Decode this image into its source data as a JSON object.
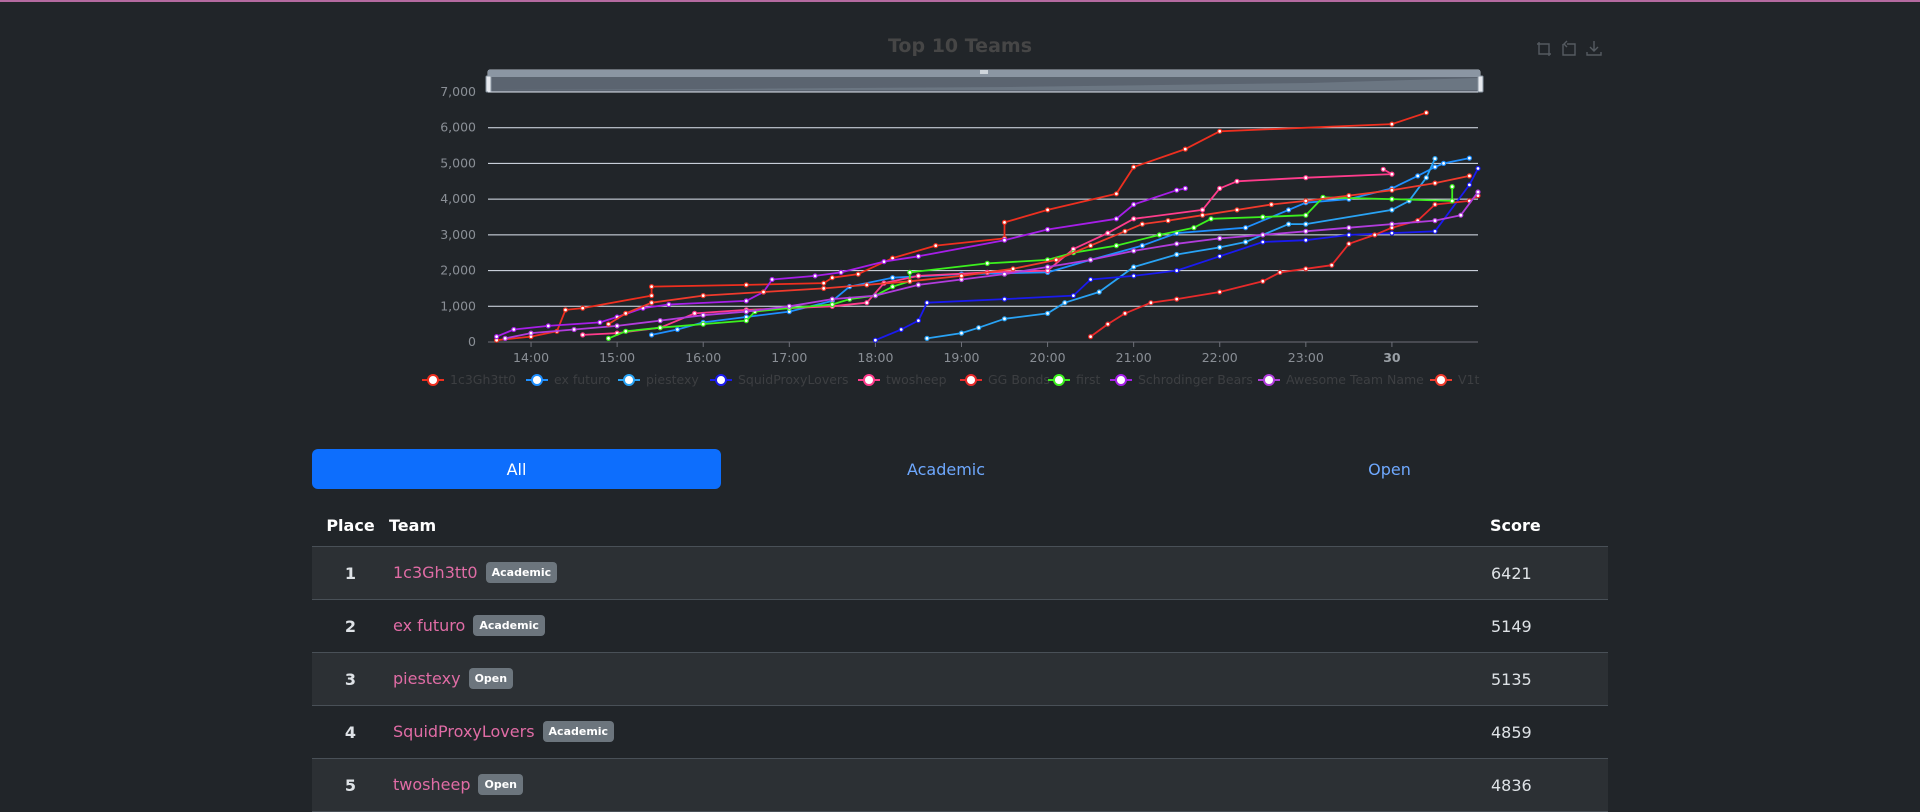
{
  "chart_data": {
    "type": "line",
    "title": "Top 10 Teams",
    "xlabel": "",
    "ylabel": "",
    "x_unit": "hours (day 29 13:30 through day 30 01:00, 24h = 30 00:00)",
    "x_tick_labels": [
      "14:00",
      "15:00",
      "16:00",
      "17:00",
      "18:00",
      "19:00",
      "20:00",
      "21:00",
      "22:00",
      "23:00",
      "30"
    ],
    "xlim": [
      13.5,
      25.0
    ],
    "ylim": [
      0,
      7000
    ],
    "y_ticks": [
      0,
      1000,
      2000,
      3000,
      4000,
      5000,
      6000,
      7000
    ],
    "y_tick_labels": [
      "0",
      "1,000",
      "2,000",
      "3,000",
      "4,000",
      "5,000",
      "6,000",
      "7,000"
    ],
    "grid": true,
    "legend_position": "bottom",
    "series": [
      {
        "name": "1c3Gh3tt0",
        "color": "#ee2f1f",
        "points": [
          [
            13.6,
            50
          ],
          [
            14.0,
            150
          ],
          [
            14.3,
            300
          ],
          [
            14.4,
            900
          ],
          [
            14.6,
            950
          ],
          [
            15.4,
            1300
          ],
          [
            15.4,
            1550
          ],
          [
            16.5,
            1600
          ],
          [
            17.4,
            1650
          ],
          [
            17.5,
            1800
          ],
          [
            17.8,
            1900
          ],
          [
            18.2,
            2350
          ],
          [
            18.7,
            2700
          ],
          [
            19.5,
            2900
          ],
          [
            19.5,
            3350
          ],
          [
            20.0,
            3700
          ],
          [
            20.8,
            4150
          ],
          [
            21.0,
            4900
          ],
          [
            21.6,
            5400
          ],
          [
            22.0,
            5900
          ],
          [
            24.0,
            6100
          ],
          [
            24.4,
            6421
          ]
        ]
      },
      {
        "name": "ex futuro",
        "color": "#1e8fff",
        "points": [
          [
            15.4,
            200
          ],
          [
            15.7,
            350
          ],
          [
            16.0,
            550
          ],
          [
            16.5,
            700
          ],
          [
            17.0,
            850
          ],
          [
            17.5,
            1150
          ],
          [
            17.7,
            1550
          ],
          [
            18.2,
            1800
          ],
          [
            19.0,
            1900
          ],
          [
            20.0,
            1950
          ],
          [
            20.5,
            2300
          ],
          [
            21.1,
            2700
          ],
          [
            21.5,
            3050
          ],
          [
            22.3,
            3200
          ],
          [
            22.8,
            3700
          ],
          [
            23.0,
            3900
          ],
          [
            23.5,
            4000
          ],
          [
            24.0,
            4300
          ],
          [
            24.3,
            4650
          ],
          [
            24.5,
            4900
          ],
          [
            24.6,
            5000
          ],
          [
            24.9,
            5149
          ]
        ]
      },
      {
        "name": "piestexy",
        "color": "#29a3f5",
        "points": [
          [
            18.6,
            100
          ],
          [
            19.0,
            250
          ],
          [
            19.2,
            400
          ],
          [
            19.5,
            650
          ],
          [
            20.0,
            800
          ],
          [
            20.2,
            1100
          ],
          [
            20.6,
            1400
          ],
          [
            21.0,
            2100
          ],
          [
            21.5,
            2450
          ],
          [
            22.0,
            2650
          ],
          [
            22.3,
            2800
          ],
          [
            22.8,
            3300
          ],
          [
            23.0,
            3300
          ],
          [
            24.0,
            3700
          ],
          [
            24.2,
            3950
          ],
          [
            24.4,
            4600
          ],
          [
            24.5,
            5135
          ]
        ]
      },
      {
        "name": "SquidProxyLovers",
        "color": "#1a1aef",
        "points": [
          [
            18.0,
            50
          ],
          [
            18.3,
            350
          ],
          [
            18.5,
            600
          ],
          [
            18.6,
            1100
          ],
          [
            19.5,
            1200
          ],
          [
            20.3,
            1300
          ],
          [
            20.5,
            1750
          ],
          [
            21.0,
            1850
          ],
          [
            21.5,
            2000
          ],
          [
            22.0,
            2400
          ],
          [
            22.5,
            2800
          ],
          [
            23.0,
            2850
          ],
          [
            23.5,
            3000
          ],
          [
            24.0,
            3050
          ],
          [
            24.5,
            3100
          ],
          [
            24.9,
            4400
          ],
          [
            25.0,
            4859
          ]
        ]
      },
      {
        "name": "twosheep",
        "color": "#ff3c8c",
        "points": [
          [
            14.6,
            200
          ],
          [
            15.0,
            250
          ],
          [
            15.5,
            400
          ],
          [
            15.9,
            800
          ],
          [
            16.5,
            900
          ],
          [
            17.5,
            1000
          ],
          [
            17.9,
            1100
          ],
          [
            18.1,
            1650
          ],
          [
            18.5,
            1850
          ],
          [
            19.3,
            1950
          ],
          [
            20.0,
            2000
          ],
          [
            20.3,
            2600
          ],
          [
            20.7,
            3050
          ],
          [
            21.0,
            3450
          ],
          [
            21.8,
            3700
          ],
          [
            22.0,
            4300
          ],
          [
            22.2,
            4500
          ],
          [
            23.0,
            4600
          ],
          [
            24.0,
            4700
          ],
          [
            23.9,
            4836
          ]
        ]
      },
      {
        "name": "GG Bonds",
        "color": "#e82a2a",
        "points": [
          [
            20.5,
            150
          ],
          [
            20.7,
            500
          ],
          [
            20.9,
            800
          ],
          [
            21.2,
            1100
          ],
          [
            21.5,
            1200
          ],
          [
            22.0,
            1400
          ],
          [
            22.5,
            1700
          ],
          [
            22.7,
            1950
          ],
          [
            23.0,
            2050
          ],
          [
            23.3,
            2150
          ],
          [
            23.5,
            2750
          ],
          [
            23.8,
            3000
          ],
          [
            24.0,
            3200
          ],
          [
            24.3,
            3400
          ],
          [
            24.5,
            3850
          ],
          [
            24.9,
            3950
          ],
          [
            25.0,
            4100
          ]
        ]
      },
      {
        "name": "first",
        "color": "#3cf01e",
        "points": [
          [
            14.9,
            100
          ],
          [
            15.1,
            300
          ],
          [
            15.5,
            400
          ],
          [
            16.0,
            500
          ],
          [
            16.5,
            600
          ],
          [
            16.6,
            850
          ],
          [
            17.0,
            950
          ],
          [
            17.5,
            1050
          ],
          [
            17.7,
            1200
          ],
          [
            18.0,
            1300
          ],
          [
            18.2,
            1550
          ],
          [
            18.4,
            1700
          ],
          [
            18.4,
            1950
          ],
          [
            19.3,
            2200
          ],
          [
            20.0,
            2300
          ],
          [
            20.3,
            2500
          ],
          [
            20.8,
            2700
          ],
          [
            21.3,
            3000
          ],
          [
            21.7,
            3200
          ],
          [
            21.9,
            3450
          ],
          [
            22.5,
            3500
          ],
          [
            23.0,
            3550
          ],
          [
            23.2,
            4050
          ],
          [
            24.0,
            4000
          ],
          [
            24.7,
            3950
          ],
          [
            24.7,
            4350
          ]
        ]
      },
      {
        "name": "Schrodinger Bears",
        "color": "#a61ee8",
        "points": [
          [
            13.6,
            150
          ],
          [
            13.8,
            350
          ],
          [
            14.2,
            450
          ],
          [
            14.8,
            550
          ],
          [
            15.0,
            700
          ],
          [
            15.3,
            950
          ],
          [
            15.6,
            1050
          ],
          [
            16.5,
            1150
          ],
          [
            16.7,
            1400
          ],
          [
            16.8,
            1750
          ],
          [
            17.3,
            1850
          ],
          [
            17.6,
            1950
          ],
          [
            18.1,
            2250
          ],
          [
            18.5,
            2400
          ],
          [
            19.5,
            2850
          ],
          [
            20.0,
            3150
          ],
          [
            20.8,
            3450
          ],
          [
            21.0,
            3850
          ],
          [
            21.5,
            4250
          ],
          [
            21.6,
            4300
          ]
        ]
      },
      {
        "name": "Awesome Team Name",
        "color": "#b13cdc",
        "points": [
          [
            13.7,
            100
          ],
          [
            14.0,
            250
          ],
          [
            14.5,
            350
          ],
          [
            15.0,
            450
          ],
          [
            15.5,
            600
          ],
          [
            16.0,
            750
          ],
          [
            16.5,
            850
          ],
          [
            17.0,
            1000
          ],
          [
            17.5,
            1200
          ],
          [
            18.0,
            1300
          ],
          [
            18.5,
            1600
          ],
          [
            19.0,
            1750
          ],
          [
            19.5,
            1900
          ],
          [
            20.0,
            2100
          ],
          [
            20.5,
            2300
          ],
          [
            21.0,
            2550
          ],
          [
            21.5,
            2750
          ],
          [
            22.0,
            2900
          ],
          [
            22.5,
            3000
          ],
          [
            23.0,
            3100
          ],
          [
            23.5,
            3200
          ],
          [
            24.0,
            3300
          ],
          [
            24.5,
            3400
          ],
          [
            24.8,
            3550
          ],
          [
            25.0,
            4200
          ]
        ]
      },
      {
        "name": "V1t",
        "color": "#f03a2c",
        "points": [
          [
            14.9,
            500
          ],
          [
            15.1,
            800
          ],
          [
            15.4,
            1100
          ],
          [
            16.0,
            1300
          ],
          [
            16.7,
            1400
          ],
          [
            17.4,
            1500
          ],
          [
            17.9,
            1600
          ],
          [
            18.4,
            1700
          ],
          [
            19.0,
            1850
          ],
          [
            19.6,
            2050
          ],
          [
            20.1,
            2300
          ],
          [
            20.5,
            2700
          ],
          [
            20.9,
            3100
          ],
          [
            21.1,
            3300
          ],
          [
            21.4,
            3400
          ],
          [
            21.8,
            3550
          ],
          [
            22.2,
            3700
          ],
          [
            22.6,
            3850
          ],
          [
            23.0,
            3950
          ],
          [
            23.5,
            4100
          ],
          [
            24.0,
            4250
          ],
          [
            24.5,
            4450
          ],
          [
            24.9,
            4650
          ]
        ]
      }
    ]
  },
  "tabs": {
    "all": "All",
    "academic": "Academic",
    "open": "Open"
  },
  "table": {
    "headers": {
      "place": "Place",
      "team": "Team",
      "score": "Score"
    },
    "rows": [
      {
        "place": "1",
        "team": "1c3Gh3tt0",
        "division": "Academic",
        "score": "6421"
      },
      {
        "place": "2",
        "team": "ex futuro",
        "division": "Academic",
        "score": "5149"
      },
      {
        "place": "3",
        "team": "piestexy",
        "division": "Open",
        "score": "5135"
      },
      {
        "place": "4",
        "team": "SquidProxyLovers",
        "division": "Academic",
        "score": "4859"
      },
      {
        "place": "5",
        "team": "twosheep",
        "division": "Open",
        "score": "4836"
      }
    ]
  },
  "toolbar": {
    "zoom_icon": "zoom-icon",
    "zoom_reset_icon": "zoom-reset-icon",
    "download_icon": "download-icon"
  },
  "colors": {
    "background": "#212529",
    "accent": "#0d6efd",
    "team_link": "#e06ca5",
    "badge": "#6c757d"
  }
}
